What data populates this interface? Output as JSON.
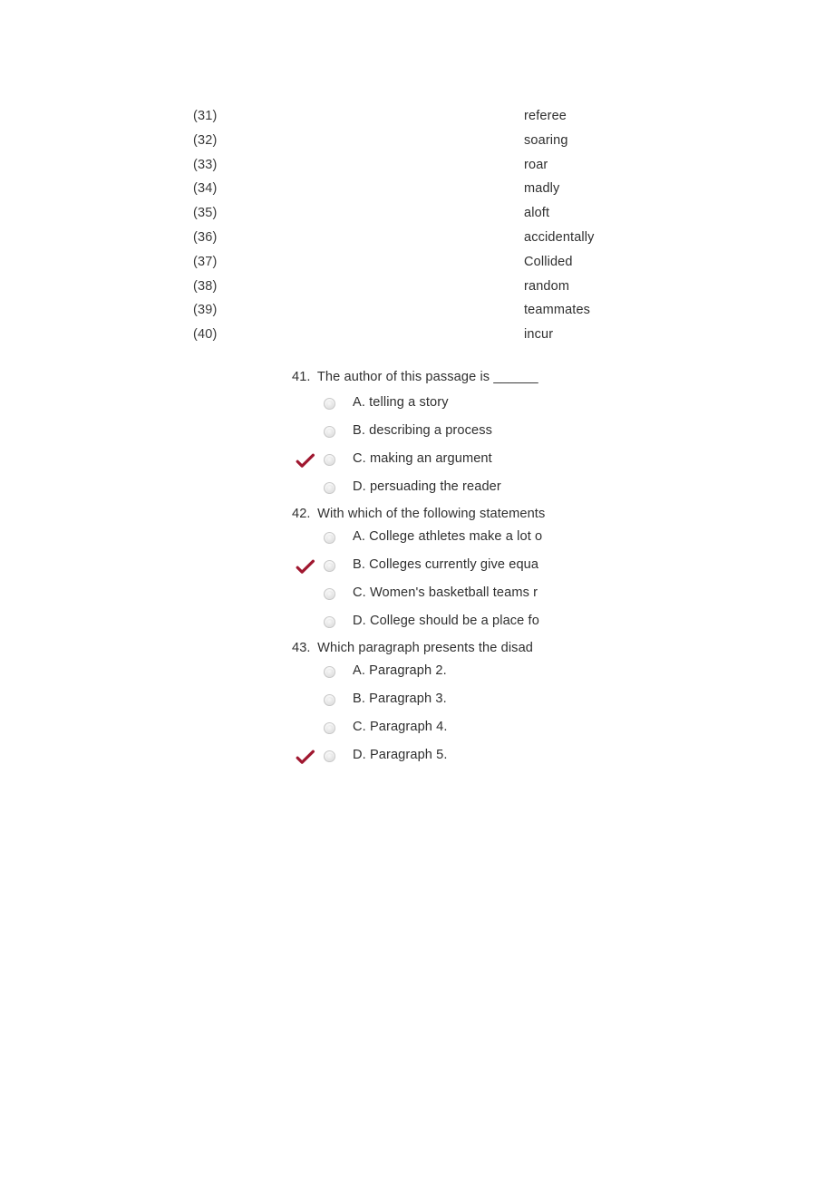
{
  "page": {
    "background_color": "#ffffff",
    "text_color": "#333333",
    "check_color": "#a01830"
  },
  "fill_in_answers": [
    {
      "number": "(31)",
      "word": "referee"
    },
    {
      "number": "(32)",
      "word": "soaring"
    },
    {
      "number": "(33)",
      "word": "roar"
    },
    {
      "number": "(34)",
      "word": "madly"
    },
    {
      "number": "(35)",
      "word": "aloft"
    },
    {
      "number": "(36)",
      "word": "accidentally"
    },
    {
      "number": "(37)",
      "word": "Collided"
    },
    {
      "number": "(38)",
      "word": "random"
    },
    {
      "number": "(39)",
      "word": "teammates"
    },
    {
      "number": "(40)",
      "word": "incur"
    }
  ],
  "questions": [
    {
      "number": "41.",
      "stem": "The author of this passage is ______",
      "options": [
        {
          "label": "A. telling a story",
          "checked": false
        },
        {
          "label": "B. describing a process",
          "checked": false
        },
        {
          "label": "C. making an argument",
          "checked": true
        },
        {
          "label": "D. persuading the reader",
          "checked": false
        }
      ]
    },
    {
      "number": "42.",
      "stem": "With which of the following statements",
      "options": [
        {
          "label": "A. College athletes make a lot o",
          "checked": false
        },
        {
          "label": "B. Colleges currently give equa",
          "checked": true
        },
        {
          "label": "C. Women's basketball teams r",
          "checked": false
        },
        {
          "label": "D. College should be a place fo",
          "checked": false
        }
      ]
    },
    {
      "number": "43.",
      "stem": "Which paragraph presents the disad",
      "options": [
        {
          "label": "A. Paragraph 2.",
          "checked": false
        },
        {
          "label": "B. Paragraph 3.",
          "checked": false
        },
        {
          "label": "C. Paragraph 4.",
          "checked": false
        },
        {
          "label": "D. Paragraph 5.",
          "checked": true
        }
      ]
    }
  ]
}
